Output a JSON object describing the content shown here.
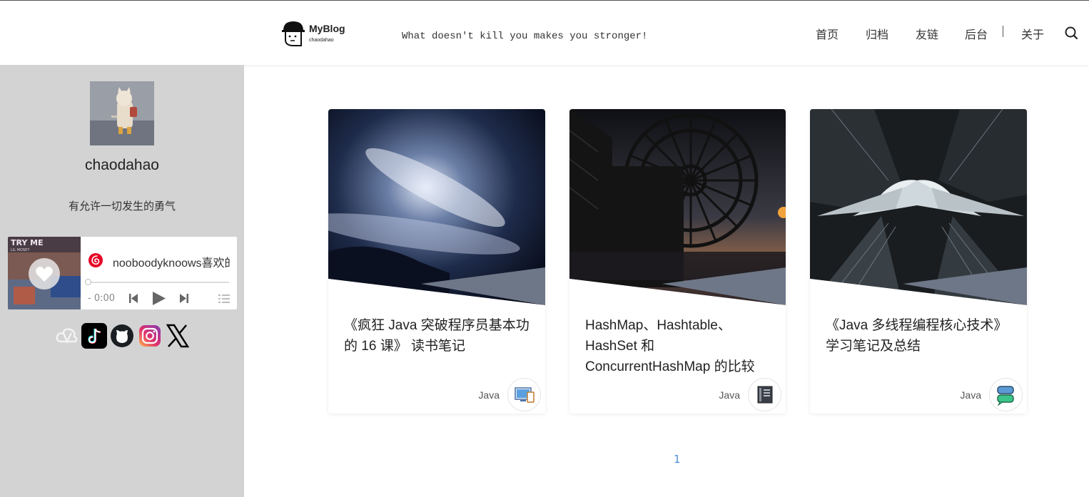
{
  "header": {
    "logo_title": "MyBlog",
    "logo_sub": "chaodahao",
    "slogan": "What doesn't kill you makes you stronger!",
    "nav": [
      "首页",
      "归档",
      "友链",
      "后台",
      "关于"
    ]
  },
  "sidebar": {
    "username": "chaodahao",
    "motto": "有允许一切发生的勇气",
    "player": {
      "cover_text": "TRY ME",
      "cover_subtext": "LIL MOSEY",
      "song": "nooboodyknoows喜欢的",
      "time": "- 0:00",
      "progress": 0
    },
    "socials": [
      "cloud-icon",
      "tiktok-icon",
      "github-icon",
      "instagram-icon",
      "x-icon"
    ]
  },
  "posts": [
    {
      "title": "《疯狂 Java 突破程序员基本功的 16 课》 读书笔记",
      "category": "Java",
      "icon": "devices-icon"
    },
    {
      "title": "HashMap、Hashtable、HashSet 和 ConcurrentHashMap 的比较",
      "category": "Java",
      "icon": "book-icon"
    },
    {
      "title": "《Java 多线程编程核心技术》学习笔记及总结",
      "category": "Java",
      "icon": "chat-icon"
    }
  ],
  "pagination": {
    "current": "1"
  },
  "colors": {
    "sidebar_bg": "#d3d3d3",
    "accent": "#4a90d9"
  }
}
